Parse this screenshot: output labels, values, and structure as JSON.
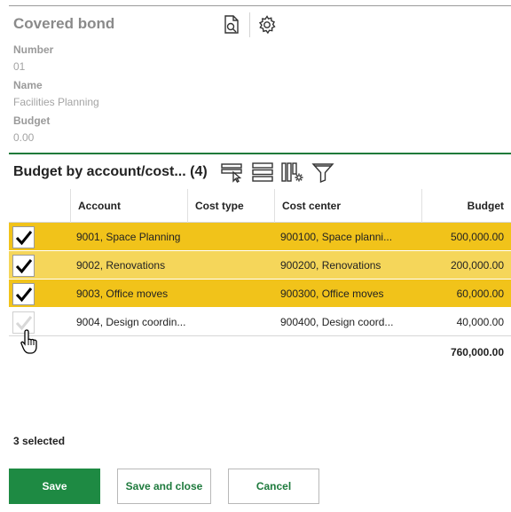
{
  "header": {
    "title": "Covered bond",
    "fields": [
      {
        "label": "Number",
        "value": "01"
      },
      {
        "label": "Name",
        "value": "Facilities Planning"
      },
      {
        "label": "Budget",
        "value": "0.00"
      }
    ]
  },
  "section": {
    "title": "Budget by account/cost... (4)"
  },
  "grid": {
    "columns": [
      "Account",
      "Cost type",
      "Cost center",
      "Budget"
    ],
    "rows": [
      {
        "account": "9001, Space Planning",
        "cost_type": "",
        "cost_center": "900100, Space planni...",
        "budget": "500,000.00",
        "selected": true
      },
      {
        "account": "9002, Renovations",
        "cost_type": "",
        "cost_center": "900200, Renovations",
        "budget": "200,000.00",
        "selected": true
      },
      {
        "account": "9003, Office moves",
        "cost_type": "",
        "cost_center": "900300, Office moves",
        "budget": "60,000.00",
        "selected": true
      },
      {
        "account": "9004, Design coordin...",
        "cost_type": "",
        "cost_center": "900400, Design coord...",
        "budget": "40,000.00",
        "selected": false
      }
    ],
    "total": "760,000.00"
  },
  "footer": {
    "selected_count": "3 selected",
    "save_label": "Save",
    "save_close_label": "Save and close",
    "cancel_label": "Cancel"
  },
  "colors": {
    "accent_green": "#1e8a43",
    "row_selected": "#f1c31a",
    "row_selected_alt": "#f5d65a"
  },
  "icons": [
    "document-search-icon",
    "gear-icon",
    "select-rows-icon",
    "list-icon",
    "column-settings-icon",
    "filter-icon",
    "hand-pointer-icon"
  ]
}
